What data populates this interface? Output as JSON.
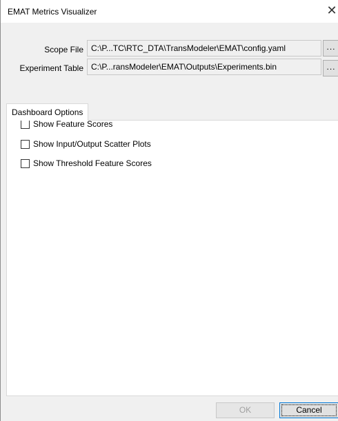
{
  "window": {
    "title": "EMAT Metrics Visualizer",
    "close_glyph": "✕"
  },
  "fields": {
    "scope_file": {
      "label": "Scope File",
      "value": "C:\\P...TC\\RTC_DTA\\TransModeler\\EMAT\\config.yaml",
      "browse_label": "..."
    },
    "experiment_table": {
      "label": "Experiment Table",
      "value": "C:\\P...ransModeler\\EMAT\\Outputs\\Experiments.bin",
      "browse_label": "..."
    }
  },
  "tabs": [
    {
      "label": "Dashboard Options",
      "active": true
    }
  ],
  "options": [
    {
      "label": "Show Feature Scores",
      "checked": false
    },
    {
      "label": "Show Input/Output Scatter Plots",
      "checked": false
    },
    {
      "label": "Show Threshold Feature Scores",
      "checked": false
    }
  ],
  "buttons": {
    "ok_label": "OK",
    "ok_enabled": false,
    "cancel_label": "Cancel"
  },
  "colors": {
    "window_bg": "#f0f0f0",
    "focus_border": "#0078d7"
  }
}
